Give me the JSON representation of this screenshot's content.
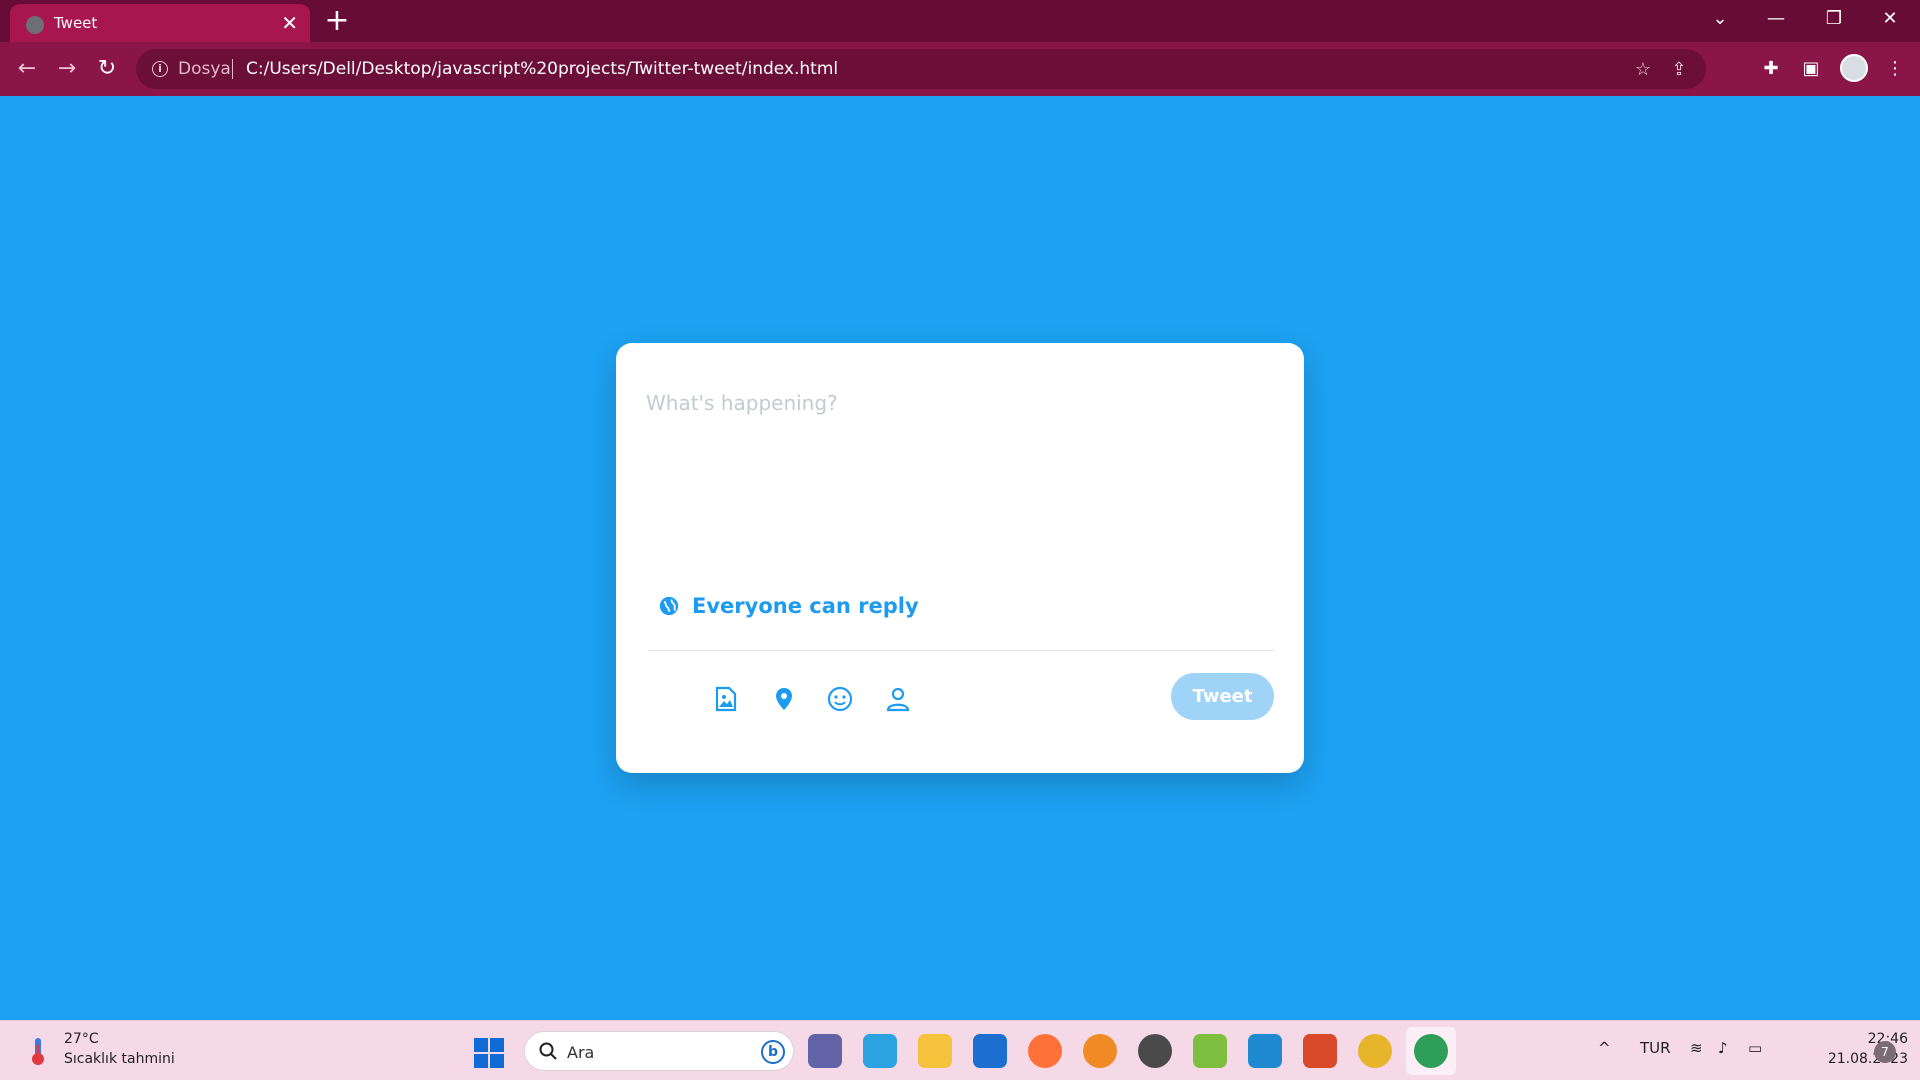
{
  "browser": {
    "tab_title": "Tweet",
    "tab_close": "✕",
    "new_tab": "+",
    "url_scheme_label": "Dosya",
    "url": "C:/Users/Dell/Desktop/javascript%20projects/Twitter-tweet/index.html"
  },
  "tweet": {
    "placeholder": "What's happening?",
    "reply_label": "Everyone can reply",
    "button_label": "Tweet",
    "accent_color": "#1d9bf0",
    "button_color": "#a0d3f8",
    "background_color": "#1da1f2"
  },
  "taskbar": {
    "weather_temp": "27°C",
    "weather_desc": "Sıcaklık tahmini",
    "search_label": "Ara",
    "language": "TUR",
    "time": "22:46",
    "date": "21.08.2023",
    "notification_count": "7"
  }
}
